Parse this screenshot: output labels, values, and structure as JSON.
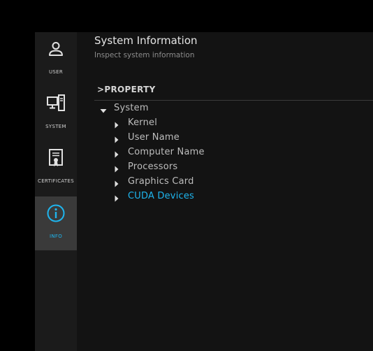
{
  "sidebar": {
    "items": [
      {
        "label": "USER",
        "icon": "user-icon"
      },
      {
        "label": "SYSTEM",
        "icon": "computer-icon"
      },
      {
        "label": "CERTIFICATES",
        "icon": "certificate-icon"
      },
      {
        "label": "INFO",
        "icon": "info-icon",
        "active": true
      }
    ]
  },
  "header": {
    "title": "System Information",
    "subtitle": "Inspect system information"
  },
  "table": {
    "column_header": ">PROPERTY"
  },
  "tree": {
    "root": {
      "label": "System",
      "expanded": true
    },
    "children": [
      {
        "label": "Kernel"
      },
      {
        "label": "User Name"
      },
      {
        "label": "Computer Name"
      },
      {
        "label": "Processors"
      },
      {
        "label": "Graphics Card"
      },
      {
        "label": "CUDA Devices",
        "highlighted": true
      }
    ]
  },
  "colors": {
    "accent": "#1eb5ee",
    "background": "#131313",
    "sidebar": "#1b1b1b",
    "active_item": "#3a3a3a"
  }
}
